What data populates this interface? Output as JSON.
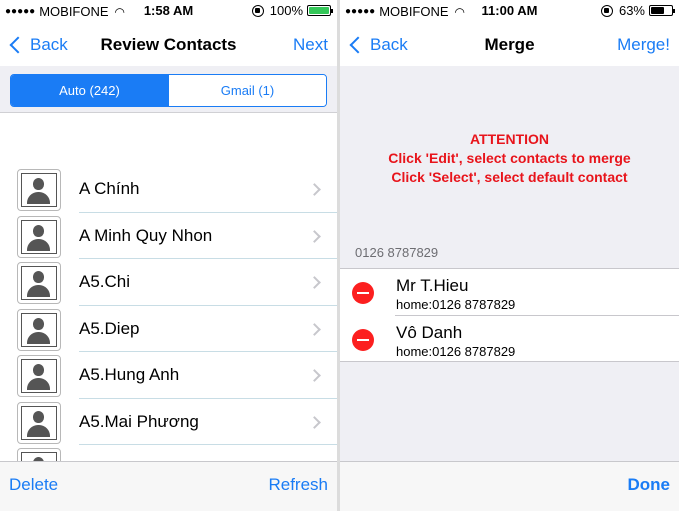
{
  "left": {
    "status": {
      "carrier": "MOBIFONE",
      "time": "1:58 AM",
      "battery": "100%",
      "battery_level": 1.0,
      "battery_color": "#34c759"
    },
    "nav": {
      "back": "Back",
      "title": "Review Contacts",
      "action": "Next"
    },
    "segments": [
      {
        "label": "Auto (242)",
        "selected": true
      },
      {
        "label": "Gmail (1)",
        "selected": false
      }
    ],
    "contacts": [
      {
        "name": "A Chính"
      },
      {
        "name": "A Minh Quy Nhon"
      },
      {
        "name": "A5.Chi"
      },
      {
        "name": "A5.Diep"
      },
      {
        "name": "A5.Hung Anh"
      },
      {
        "name": "A5.Mai Phương"
      },
      {
        "name": ""
      }
    ],
    "toolbar": {
      "left": "Delete",
      "right": "Refresh"
    }
  },
  "right": {
    "status": {
      "carrier": "MOBIFONE",
      "time": "11:00 AM",
      "battery": "63%",
      "battery_level": 0.63,
      "battery_color": "#000000"
    },
    "nav": {
      "back": "Back",
      "title": "Merge",
      "action": "Merge!"
    },
    "attention": {
      "title": "ATTENTION",
      "line1": "Click 'Edit', select contacts to merge",
      "line2": "Click 'Select', select default contact"
    },
    "phone_header": "0126 8787829",
    "entries": [
      {
        "name": "Mr T.Hieu",
        "detail": "home:0126 8787829"
      },
      {
        "name": "Vô Danh",
        "detail": "home:0126 8787829"
      }
    ],
    "toolbar": {
      "right": "Done"
    }
  },
  "accent_color": "#1a7cf5",
  "attention_color": "#e8141b"
}
